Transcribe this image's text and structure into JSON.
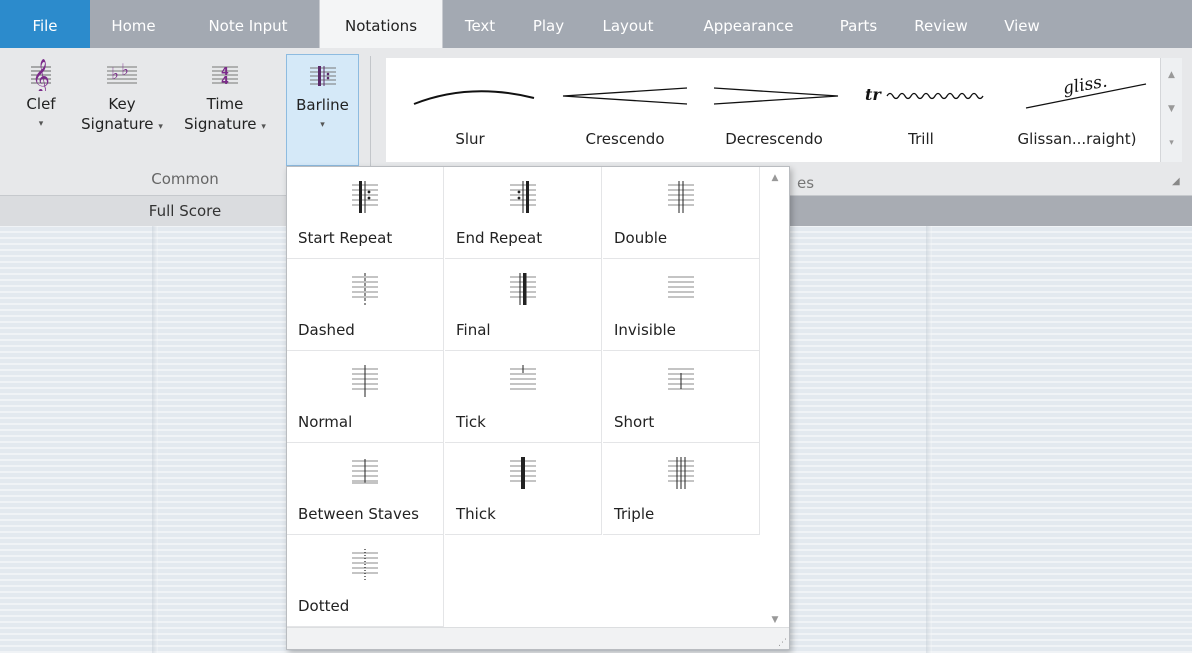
{
  "tabs": [
    {
      "label": "File",
      "kind": "file"
    },
    {
      "label": "Home"
    },
    {
      "label": "Note Input"
    },
    {
      "label": "Notations",
      "kind": "active"
    },
    {
      "label": "Text"
    },
    {
      "label": "Play"
    },
    {
      "label": "Layout"
    },
    {
      "label": "Appearance"
    },
    {
      "label": "Parts"
    },
    {
      "label": "Review"
    },
    {
      "label": "View"
    }
  ],
  "ribbon": {
    "clef": {
      "line1": "Clef",
      "line2": ""
    },
    "key_signature": {
      "line1": "Key",
      "line2": "Signature"
    },
    "time_signature": {
      "line1": "Time",
      "line2": "Signature"
    },
    "barline": {
      "line1": "Barline"
    },
    "common_group_label": "Common",
    "lines_group_label_partial": "es"
  },
  "gallery": {
    "items": [
      {
        "label": "Slur",
        "icon": "slur-icon"
      },
      {
        "label": "Crescendo",
        "icon": "crescendo-icon"
      },
      {
        "label": "Decrescendo",
        "icon": "decrescendo-icon"
      },
      {
        "label": "Trill",
        "icon": "trill-icon",
        "glyph": "tr"
      },
      {
        "label": "Glissan...raight)",
        "icon": "glissando-icon",
        "glyph": "gliss."
      }
    ]
  },
  "score_tab": {
    "label": "Full Score"
  },
  "barlines": [
    {
      "label": "Start Repeat",
      "icon": "start-repeat-barline-icon"
    },
    {
      "label": "End Repeat",
      "icon": "end-repeat-barline-icon"
    },
    {
      "label": "Double",
      "icon": "double-barline-icon"
    },
    {
      "label": "Dashed",
      "icon": "dashed-barline-icon"
    },
    {
      "label": "Final",
      "icon": "final-barline-icon"
    },
    {
      "label": "Invisible",
      "icon": "invisible-barline-icon"
    },
    {
      "label": "Normal",
      "icon": "normal-barline-icon"
    },
    {
      "label": "Tick",
      "icon": "tick-barline-icon"
    },
    {
      "label": "Short",
      "icon": "short-barline-icon"
    },
    {
      "label": "Between Staves",
      "icon": "between-staves-barline-icon"
    },
    {
      "label": "Thick",
      "icon": "thick-barline-icon"
    },
    {
      "label": "Triple",
      "icon": "triple-barline-icon"
    },
    {
      "label": "Dotted",
      "icon": "dotted-barline-icon"
    }
  ],
  "colors": {
    "file_tab": "#2c8bcc",
    "tabbar": "#a3a9b2",
    "active_button": "#d5e9f8"
  }
}
